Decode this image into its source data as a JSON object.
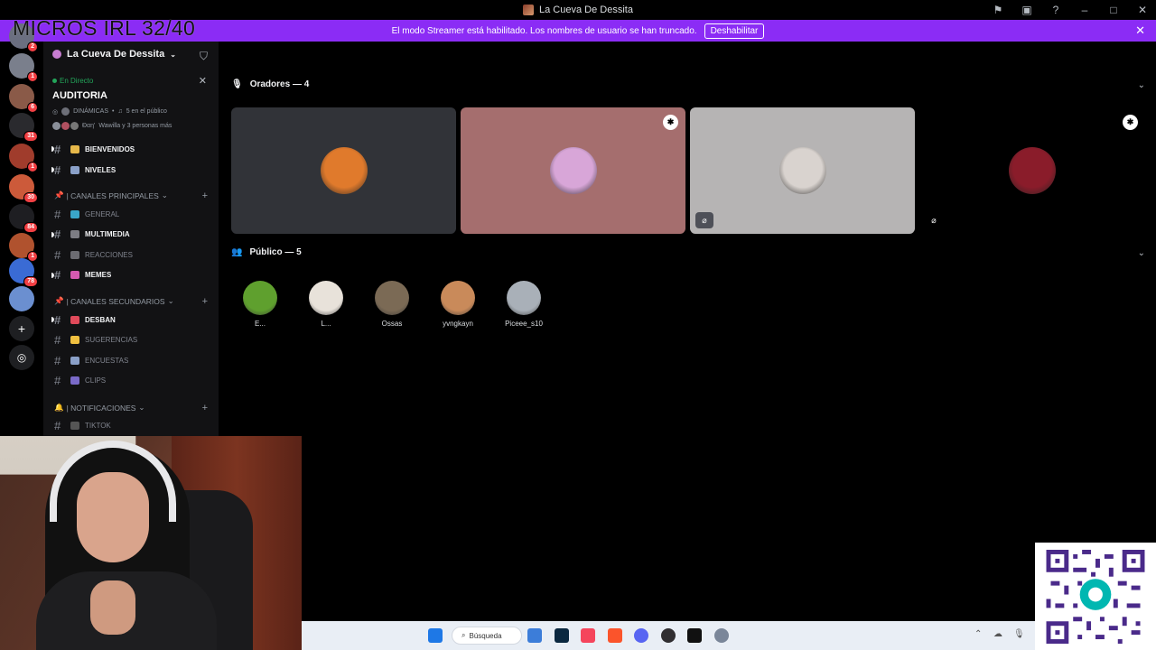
{
  "window": {
    "title": "La Cueva De Dessita",
    "controls": [
      "flag-icon",
      "inbox-icon",
      "help-icon",
      "minimize-icon",
      "maximize-icon",
      "close-icon"
    ]
  },
  "overlay": {
    "text": "MICROS IRL 32/40"
  },
  "banner": {
    "message": "El modo Streamer está habilitado. Los nombres de usuario se han truncado.",
    "button_label": "Deshabilitar"
  },
  "servers": [
    {
      "icon": "server-icon",
      "badge": "2",
      "color": "#6b6f80"
    },
    {
      "icon": "server-icon",
      "badge": "1",
      "color": "#7a7f8c"
    },
    {
      "icon": "server-icon",
      "badge": "6",
      "color": "#8a5a48"
    },
    {
      "icon": "server-icon",
      "badge": "31",
      "color": "#2a2a2e"
    },
    {
      "icon": "server-icon",
      "badge": "1",
      "color": "#a03c2c"
    },
    {
      "icon": "server-icon",
      "badge": "30",
      "color": "#cc5a3a"
    },
    {
      "icon": "server-icon",
      "badge": "84",
      "color": "#1e1e22"
    },
    {
      "icon": "server-icon",
      "badge": "1",
      "color": "#b0522e"
    },
    {
      "icon": "server-icon",
      "badge": "78",
      "color": "#3a6bd4"
    },
    {
      "icon": "server-icon",
      "badge": "",
      "color": "#6b8fd0"
    }
  ],
  "sidebar": {
    "guild_name": "La Cueva De Dessita",
    "live_label": "En Directo",
    "stage_name": "AUDITORIA",
    "stage_info_1_topic": "DINÁMICAS",
    "stage_info_1_audience": "5 en el público",
    "stage_info_2_text": "Wawilla y 3 personas más",
    "stage_info_2_prefix": "Ðαη'",
    "channels_top": [
      {
        "name": "BIENVENIDOS",
        "bold": true,
        "emo": "#e6b84a"
      },
      {
        "name": "NIVELES",
        "bold": true,
        "emo": "#8aa0c8"
      }
    ],
    "cat_1": "| CANALES PRINCIPALES",
    "channels_main": [
      {
        "name": "GENERAL",
        "bold": false,
        "emo": "#3aa6c9"
      },
      {
        "name": "MULTIMEDIA",
        "bold": true,
        "emo": "#7d7d84"
      },
      {
        "name": "REACCIONES",
        "bold": false,
        "emo": "#6c6c72"
      },
      {
        "name": "MEMES",
        "bold": true,
        "emo": "#d45ab0"
      }
    ],
    "cat_2": "| CANALES SECUNDARIOS",
    "channels_secondary": [
      {
        "name": "DESBAN",
        "bold": true,
        "emo": "#e04a5a"
      },
      {
        "name": "SUGERENCIAS",
        "bold": false,
        "emo": "#f0c040"
      },
      {
        "name": "ENCUESTAS",
        "bold": false,
        "emo": "#8aa0c8"
      },
      {
        "name": "CLIPS",
        "bold": false,
        "emo": "#7a6ac8"
      }
    ],
    "cat_3": "| NOTIFICACIONES",
    "channels_notif": [
      {
        "name": "TIKTOK",
        "bold": false,
        "emo": "#555"
      }
    ]
  },
  "stage": {
    "speakers_label": "Oradores — 4",
    "audience_label": "Público — 5",
    "speakers": [
      {
        "bg": "#313338",
        "avatar": "#e07a2c",
        "moderator": false,
        "muted": false
      },
      {
        "bg": "#a56e6e",
        "avatar": "#d8a6d8",
        "moderator": true,
        "muted": false
      },
      {
        "bg": "#b6b4b4",
        "avatar": "#d9d3cf",
        "moderator": false,
        "muted": true
      },
      {
        "bg": "#000000",
        "avatar": "#8a1c2a",
        "moderator": true,
        "muted": true
      }
    ],
    "audience": [
      {
        "name": "E...",
        "color": "#5fa02e"
      },
      {
        "name": "L...",
        "color": "#e8e2da"
      },
      {
        "name": "Ossas",
        "color": "#7b6a55"
      },
      {
        "name": "yvngkayn",
        "color": "#c98a5a"
      },
      {
        "name": "Piceee_s10",
        "color": "#a9b0b8"
      }
    ]
  },
  "taskbar": {
    "search_placeholder": "Búsqueda",
    "apps": [
      "windows-start-icon",
      "file-explorer-icon",
      "photoshop-icon",
      "itunes-icon",
      "brave-icon",
      "discord-icon",
      "obs-icon",
      "capcut-icon",
      "settings-icon"
    ]
  }
}
